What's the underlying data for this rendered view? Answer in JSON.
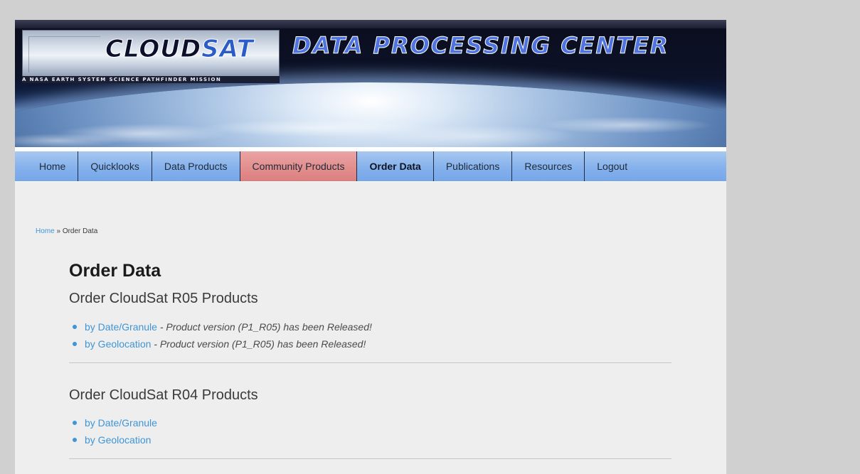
{
  "header": {
    "logo_word_part1": "CLOUD",
    "logo_word_part2": "SAT",
    "tagline": "A NASA EARTH SYSTEM SCIENCE PATHFINDER MISSION",
    "title": "DATA PROCESSING CENTER"
  },
  "nav": {
    "items": [
      {
        "label": "Home"
      },
      {
        "label": "Quicklooks"
      },
      {
        "label": "Data Products"
      },
      {
        "label": "Community Products"
      },
      {
        "label": "Order Data"
      },
      {
        "label": "Publications"
      },
      {
        "label": "Resources"
      },
      {
        "label": "Logout"
      }
    ],
    "active": "Order Data",
    "highlighted": "Community Products"
  },
  "breadcrumb": {
    "home": "Home",
    "separator": " » ",
    "current": "Order Data"
  },
  "content": {
    "title": "Order Data",
    "sections": [
      {
        "heading": "Order CloudSat R05 Products",
        "links": [
          {
            "label": "by Date/Granule",
            "note": " - Product version (P1_R05) has been Released!"
          },
          {
            "label": "by Geolocation",
            "note": " - Product version (P1_R05) has been Released!"
          }
        ]
      },
      {
        "heading": "Order CloudSat R04 Products",
        "links": [
          {
            "label": "by Date/Granule"
          },
          {
            "label": "by Geolocation"
          }
        ]
      }
    ]
  },
  "colors": {
    "page_background": "#d0d0d0",
    "content_background": "#eeeeee",
    "nav_background": "#85b1ec",
    "nav_highlight": "#dd7e7e",
    "link": "#3f95d6"
  }
}
